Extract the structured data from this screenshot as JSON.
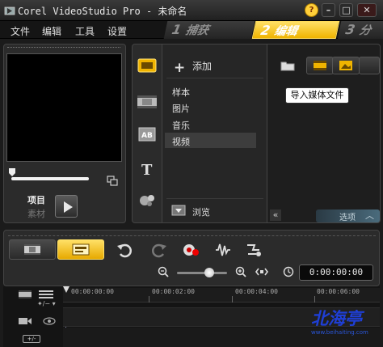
{
  "window": {
    "title": "Corel VideoStudio Pro - 未命名"
  },
  "menu": {
    "items": [
      "文件",
      "编辑",
      "工具",
      "设置"
    ]
  },
  "steps": [
    {
      "num": "1",
      "label": "捕获"
    },
    {
      "num": "2",
      "label": "编辑"
    },
    {
      "num": "3",
      "label": "分"
    }
  ],
  "preview": {
    "project_label": "项目",
    "clip_label": "素材"
  },
  "library": {
    "add_label": "添加",
    "folders": [
      "样本",
      "图片",
      "音乐",
      "视频"
    ],
    "selected_folder": "视频",
    "browse_label": "浏览",
    "tooltip": "导入媒体文件",
    "options_label": "选项"
  },
  "timeline": {
    "timecode": "0:00:00:00",
    "ruler": [
      "00:00:00:00",
      "00:00:02:00",
      "00:00:04:00",
      "00:00:06:00"
    ],
    "add_track_label": "+/-"
  },
  "watermark": {
    "text": "北海亭",
    "url_text": "www.beihaiting.com"
  },
  "colors": {
    "accent": "#f0b400",
    "background": "#1b1b1b",
    "watermark": "#1f3fd6"
  }
}
